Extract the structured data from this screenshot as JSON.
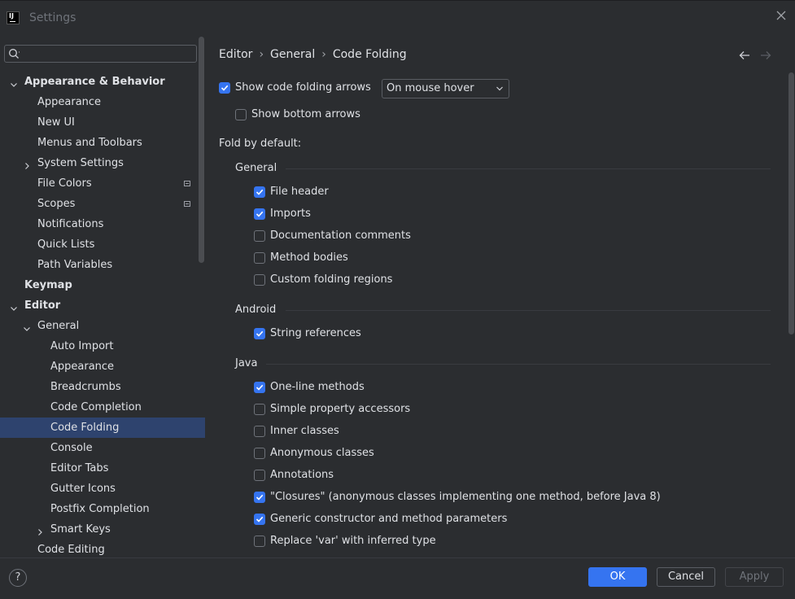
{
  "window": {
    "title": "Settings"
  },
  "search": {
    "placeholder": ""
  },
  "tree": [
    {
      "label": "Appearance & Behavior",
      "bold": true,
      "depth": 0,
      "expander": "down"
    },
    {
      "label": "Appearance",
      "depth": 1
    },
    {
      "label": "New UI",
      "depth": 1
    },
    {
      "label": "Menus and Toolbars",
      "depth": 1
    },
    {
      "label": "System Settings",
      "depth": 1,
      "expander": "right"
    },
    {
      "label": "File Colors",
      "depth": 1,
      "project_icon": true
    },
    {
      "label": "Scopes",
      "depth": 1,
      "project_icon": true
    },
    {
      "label": "Notifications",
      "depth": 1
    },
    {
      "label": "Quick Lists",
      "depth": 1
    },
    {
      "label": "Path Variables",
      "depth": 1
    },
    {
      "label": "Keymap",
      "bold": true,
      "depth": 0
    },
    {
      "label": "Editor",
      "bold": true,
      "depth": 0,
      "expander": "down"
    },
    {
      "label": "General",
      "depth": 1,
      "expander": "down"
    },
    {
      "label": "Auto Import",
      "depth": 2
    },
    {
      "label": "Appearance",
      "depth": 2
    },
    {
      "label": "Breadcrumbs",
      "depth": 2
    },
    {
      "label": "Code Completion",
      "depth": 2
    },
    {
      "label": "Code Folding",
      "depth": 2,
      "selected": true
    },
    {
      "label": "Console",
      "depth": 2
    },
    {
      "label": "Editor Tabs",
      "depth": 2
    },
    {
      "label": "Gutter Icons",
      "depth": 2
    },
    {
      "label": "Postfix Completion",
      "depth": 2
    },
    {
      "label": "Smart Keys",
      "depth": 2,
      "expander": "right"
    },
    {
      "label": "Code Editing",
      "depth": 1
    }
  ],
  "breadcrumb": [
    "Editor",
    "General",
    "Code Folding"
  ],
  "content": {
    "show_arrows": {
      "label": "Show code folding arrows",
      "checked": true
    },
    "arrows_mode": "On mouse hover",
    "show_bottom": {
      "label": "Show bottom arrows",
      "checked": false
    },
    "fold_default_label": "Fold by default:",
    "groups": [
      {
        "title": "General",
        "items": [
          {
            "label": "File header",
            "checked": true
          },
          {
            "label": "Imports",
            "checked": true
          },
          {
            "label": "Documentation comments",
            "checked": false
          },
          {
            "label": "Method bodies",
            "checked": false
          },
          {
            "label": "Custom folding regions",
            "checked": false
          }
        ]
      },
      {
        "title": "Android",
        "items": [
          {
            "label": "String references",
            "checked": true
          }
        ]
      },
      {
        "title": "Java",
        "items": [
          {
            "label": "One-line methods",
            "checked": true
          },
          {
            "label": "Simple property accessors",
            "checked": false
          },
          {
            "label": "Inner classes",
            "checked": false
          },
          {
            "label": "Anonymous classes",
            "checked": false
          },
          {
            "label": "Annotations",
            "checked": false
          },
          {
            "label": "\"Closures\" (anonymous classes implementing one method, before Java 8)",
            "checked": true
          },
          {
            "label": "Generic constructor and method parameters",
            "checked": true
          },
          {
            "label": "Replace 'var' with inferred type",
            "checked": false
          },
          {
            "label": "",
            "checked": true
          }
        ]
      }
    ]
  },
  "footer": {
    "help": "?",
    "ok": "OK",
    "cancel": "Cancel",
    "apply": "Apply"
  },
  "colors": {
    "accent": "#3574f0",
    "selection": "#2e436e",
    "background": "#2b2d30"
  },
  "icons": [
    "app-icon",
    "close-icon",
    "search-icon",
    "chevron-down-icon",
    "chevron-right-icon",
    "project-scope-icon",
    "back-arrow-icon",
    "forward-arrow-icon",
    "checkmark-icon",
    "help-icon"
  ]
}
